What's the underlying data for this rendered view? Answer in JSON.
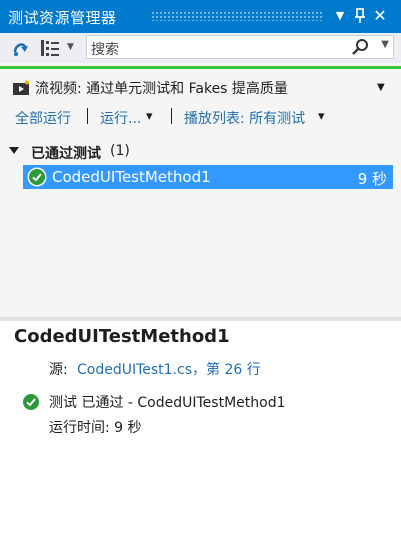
{
  "window": {
    "title": "测试资源管理器",
    "dropdown_glyph": "▼",
    "pin_glyph": "ᛘ",
    "close_glyph": "✕"
  },
  "toolbar": {
    "search_placeholder": "搜索",
    "search_dropdown_glyph": "▼"
  },
  "promo": {
    "text": "流视频: 通过单元测试和 Fakes 提高质量"
  },
  "actions": {
    "run_all": "全部运行",
    "run": "运行...",
    "playlist": "播放列表: 所有测试",
    "dropdown_glyph": "▾"
  },
  "test_list": {
    "group_label": "已通过测试",
    "group_count": "(1)",
    "items": [
      {
        "name": "CodedUITestMethod1",
        "time": "9 秒"
      }
    ]
  },
  "detail": {
    "title": "CodedUITestMethod1",
    "source_label": "源:",
    "source_link": "CodedUITest1.cs，第 26 行",
    "status": "测试 已通过 - CodedUITestMethod1",
    "runtime": "运行时间: 9 秒"
  },
  "colors": {
    "titlebar": "#007acc",
    "selection": "#3399ff",
    "passed_green": "#2b9a3b",
    "link": "#1e6fb3",
    "progress_bar": "#39c639"
  }
}
